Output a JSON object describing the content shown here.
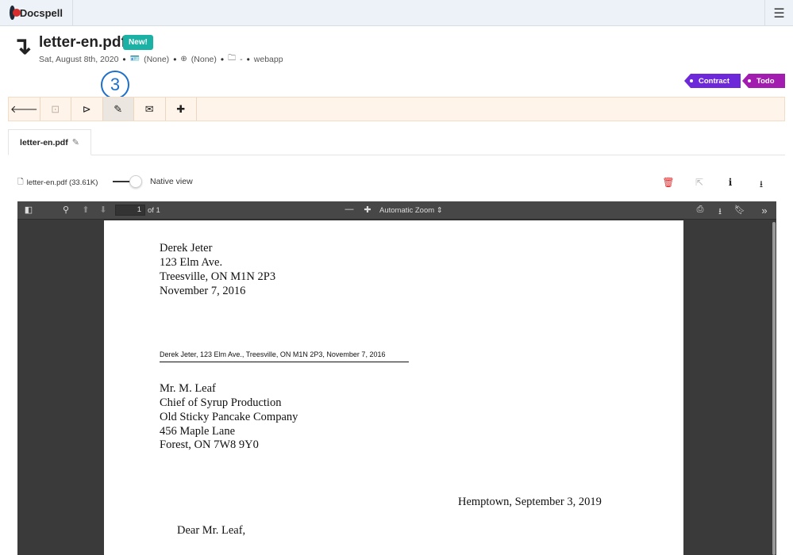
{
  "app": {
    "name": "Docspell"
  },
  "header": {
    "title": "letter-en.pdf",
    "new_badge": "New!",
    "date": "Sat, August 8th, 2020",
    "correspondent": "(None)",
    "concerning": "(None)",
    "folder": "-",
    "source": "webapp"
  },
  "tags": [
    "Contract",
    "Todo"
  ],
  "step_marker": "3",
  "toolbar": {
    "buttons": [
      "back-arrow-icon",
      "prev-icon",
      "preview-icon",
      "edit-icon",
      "mail-icon",
      "plus-icon"
    ]
  },
  "tab": {
    "label": "letter-en.pdf"
  },
  "attachment": {
    "file_label": "letter-en.pdf (33.61K)",
    "native_view_label": "Native view"
  },
  "viewer": {
    "page_number": "1",
    "of_label": "of 1",
    "zoom_label": "Automatic Zoom"
  },
  "pdf": {
    "sender_lines": [
      "Derek Jeter",
      "123 Elm Ave.",
      "Treesville, ON M1N 2P3",
      "November 7, 2016"
    ],
    "return_address": "Derek Jeter, 123 Elm Ave., Treesville, ON M1N 2P3, November 7, 2016",
    "recipient_lines": [
      "Mr. M. Leaf",
      "Chief of Syrup Production",
      "Old Sticky Pancake Company",
      "456 Maple Lane",
      "Forest, ON 7W8 9Y0"
    ],
    "place_date": "Hemptown, September 3, 2019",
    "salutation": "Dear Mr. Leaf,"
  },
  "colors": {
    "topbar_bg": "#edf2f8",
    "new_badge": "#1bb2a5",
    "tag_contract": "#6d28d9",
    "tag_todo": "#a21caf",
    "toolbar_bg": "#fef4ea",
    "step_marker": "#1d6fc9",
    "delete_icon": "#dc2626"
  }
}
